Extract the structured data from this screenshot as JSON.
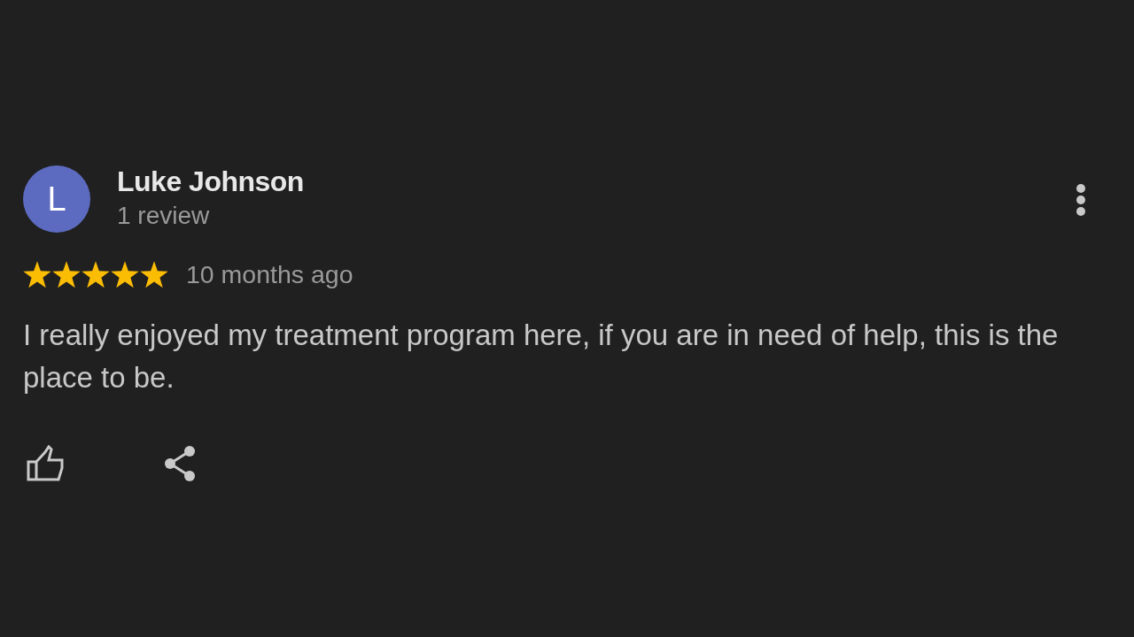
{
  "review": {
    "author": {
      "initial": "L",
      "name": "Luke Johnson",
      "review_count": "1 review"
    },
    "stars": 5,
    "time": "10 months ago",
    "text": "I really enjoyed my treatment program here, if you are in need of help, this is the place to be."
  }
}
